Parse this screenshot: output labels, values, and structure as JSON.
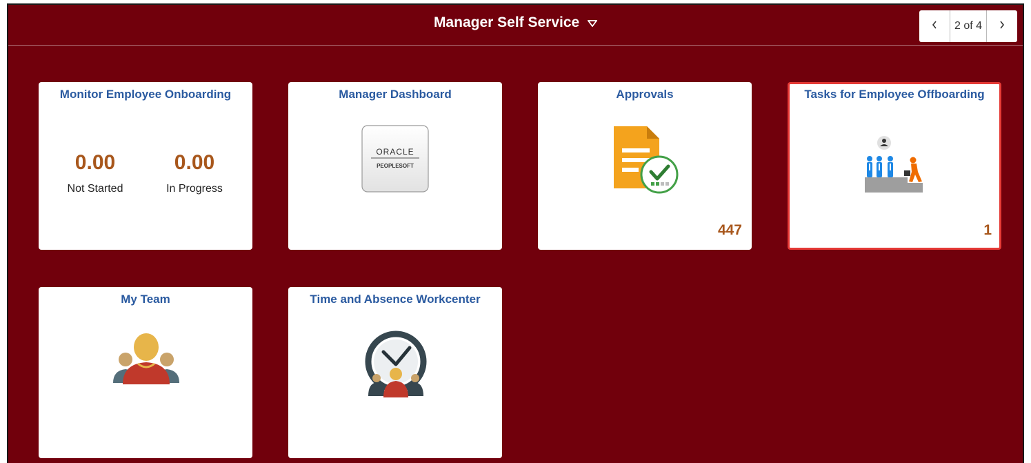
{
  "header": {
    "title": "Manager Self Service",
    "title_icon": "caret-down-icon",
    "pager": {
      "prev_icon": "chevron-left-icon",
      "current": "2 of 4",
      "next_icon": "chevron-right-icon"
    }
  },
  "tiles": [
    {
      "title": "Monitor Employee Onboarding",
      "kpis": [
        {
          "value": "0.00",
          "label": "Not Started"
        },
        {
          "value": "0.00",
          "label": "In Progress"
        }
      ]
    },
    {
      "title": "Manager Dashboard",
      "logo_text": {
        "brand": "ORACLE",
        "product": "PEOPLESOFT"
      },
      "icon": "oracle-peoplesoft-logo"
    },
    {
      "title": "Approvals",
      "count": "447",
      "icon": "approval-document-icon"
    },
    {
      "title": "Tasks for Employee Offboarding",
      "count": "1",
      "icon": "employee-offboarding-icon",
      "selected": true
    },
    {
      "title": "My Team",
      "icon": "team-people-icon"
    },
    {
      "title": "Time and Absence Workcenter",
      "icon": "clock-team-icon"
    }
  ],
  "colors": {
    "background": "#71000c",
    "tile_title": "#2a5aa0",
    "kpi_value": "#a8571c",
    "selected_border": "#e53935"
  }
}
